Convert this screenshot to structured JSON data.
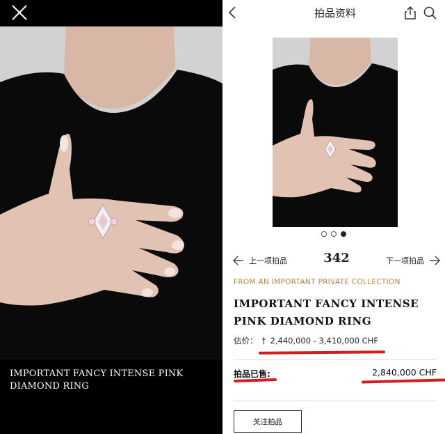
{
  "viewer": {
    "caption": "IMPORTANT FANCY INTENSE PINK DIAMOND RING"
  },
  "header": {
    "title": "拍品资料"
  },
  "gallery": {
    "dot_count": 3,
    "active_index": 2
  },
  "navigation": {
    "prev_label": "上一项拍品",
    "next_label": "下一项拍品",
    "lot_number": "342"
  },
  "lot": {
    "provenance": "FROM AN IMPORTANT PRIVATE COLLECTION",
    "title": "IMPORTANT FANCY INTENSE PINK DIAMOND RING",
    "estimate_label": "估价：",
    "estimate_symbol": "†",
    "estimate_value": "2,440,000 - 3,410,000 CHF",
    "sold_label": "拍品已售:",
    "sold_price": "2,840,000 CHF",
    "follow_label": "关注拍品"
  },
  "colors": {
    "accent_gold": "#a88a4a",
    "highlight_red": "#d31e1e",
    "background_black": "#000000"
  }
}
